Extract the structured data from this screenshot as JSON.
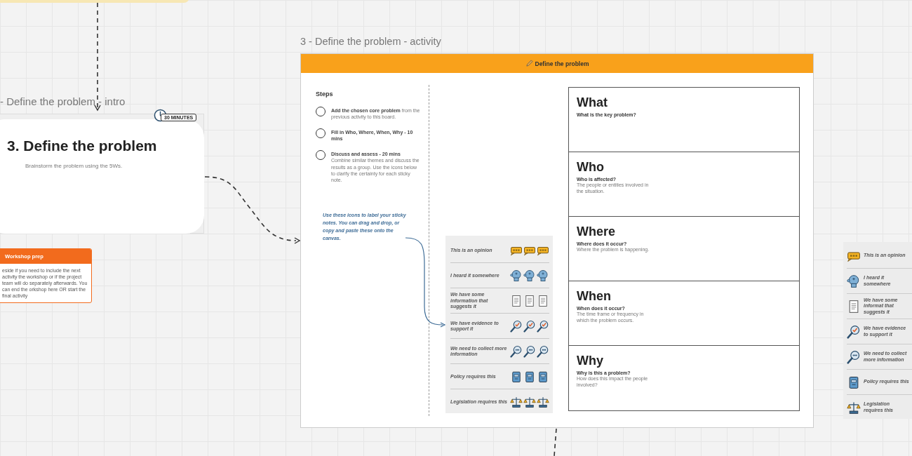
{
  "intro_frame": {
    "title": "- Define the problem - intro",
    "card": {
      "heading": "3. Define the problem",
      "subtitle": "Brainstorm the problem using the 5Ws.",
      "timer": "30 MINUTES"
    }
  },
  "workshop_prep": {
    "title": "Workshop prep",
    "text": "eside if you need to include the next activity the workshop or if the project team will do separately afterwards. You can end the orkshop here OR start the final activity"
  },
  "activity_frame": {
    "title": "3 - Define the problem - activity",
    "banner": "Define the problem",
    "steps_heading": "Steps",
    "steps": [
      {
        "text": "**Add the chosen core problem** from the previous activity to this board.",
        "checked": false
      },
      {
        "title": "Fill in Who, Where, When, Why - 10 mins",
        "checked": false
      },
      {
        "title": "Discuss and assess - 20 mins",
        "text": "Combine similar themes and discuss the results as a group. Use the icons below to clarify the certainty for each sticky note.",
        "checked": false
      }
    ],
    "note": "Use these icons to label your sticky notes. You can drag and drop, or copy and paste these onto the canvas.",
    "legend": [
      {
        "kind": "opinion",
        "label": "This is an opinion"
      },
      {
        "kind": "heard",
        "label": "I heard it somewhere"
      },
      {
        "kind": "info",
        "label": "We have some information that suggests it"
      },
      {
        "kind": "evidence",
        "label": "We have evidence to support it"
      },
      {
        "kind": "collect",
        "label": "We need to collect more information"
      },
      {
        "kind": "policy",
        "label": "Policy requires this"
      },
      {
        "kind": "legislation",
        "label": "Legislation requires this"
      }
    ],
    "w_boxes": [
      {
        "title": "What",
        "question": "What is the key problem?"
      },
      {
        "title": "Who",
        "question": "Who is affected?",
        "description": "The people or entities involved in the situation."
      },
      {
        "title": "Where",
        "question": "Where does it occur?",
        "description": "Where the problem is happening."
      },
      {
        "title": "When",
        "question": "When does it occur?",
        "description": "The time frame or frequency in which the problem occurs."
      },
      {
        "title": "Why",
        "question": "Why is this a problem?",
        "description": "How does this impact the people involved?"
      }
    ]
  },
  "side_legend": [
    {
      "kind": "opinion",
      "label": "This is an opinion"
    },
    {
      "kind": "heard",
      "label": "I heard it somewhere"
    },
    {
      "kind": "info",
      "label": "We have some informat that suggests it"
    },
    {
      "kind": "evidence",
      "label": "We have evidence to support it"
    },
    {
      "kind": "collect",
      "label": "We need to collect more information"
    },
    {
      "kind": "policy",
      "label": "Policy requires this"
    },
    {
      "kind": "legislation",
      "label": "Legislation requires this"
    }
  ]
}
